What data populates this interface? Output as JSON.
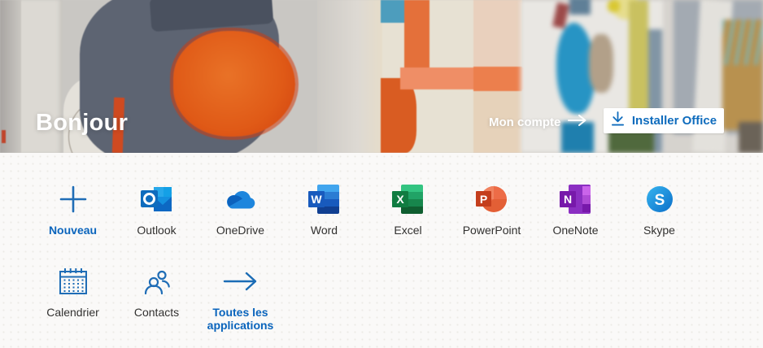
{
  "banner": {
    "greeting": "Bonjour",
    "account_link_label": "Mon compte",
    "install_button_label": "Installer Office"
  },
  "apps": {
    "row1": [
      {
        "label": "Nouveau",
        "icon": "plus-icon",
        "highlighted": true
      },
      {
        "label": "Outlook",
        "icon": "outlook-icon",
        "highlighted": false
      },
      {
        "label": "OneDrive",
        "icon": "onedrive-icon",
        "highlighted": false
      },
      {
        "label": "Word",
        "icon": "word-icon",
        "highlighted": false
      },
      {
        "label": "Excel",
        "icon": "excel-icon",
        "highlighted": false
      },
      {
        "label": "PowerPoint",
        "icon": "powerpoint-icon",
        "highlighted": false
      },
      {
        "label": "OneNote",
        "icon": "onenote-icon",
        "highlighted": false
      },
      {
        "label": "Skype",
        "icon": "skype-icon",
        "highlighted": false
      }
    ],
    "row2": [
      {
        "label": "Calendrier",
        "icon": "calendar-icon",
        "highlighted": false
      },
      {
        "label": "Contacts",
        "icon": "contacts-icon",
        "highlighted": false
      },
      {
        "label": "Toutes les applications",
        "icon": "arrow-right-icon",
        "highlighted": true
      }
    ]
  },
  "colors": {
    "accent_blue": "#0a64bc",
    "button_text_blue": "#0f6cbd",
    "label_text": "#323130"
  }
}
